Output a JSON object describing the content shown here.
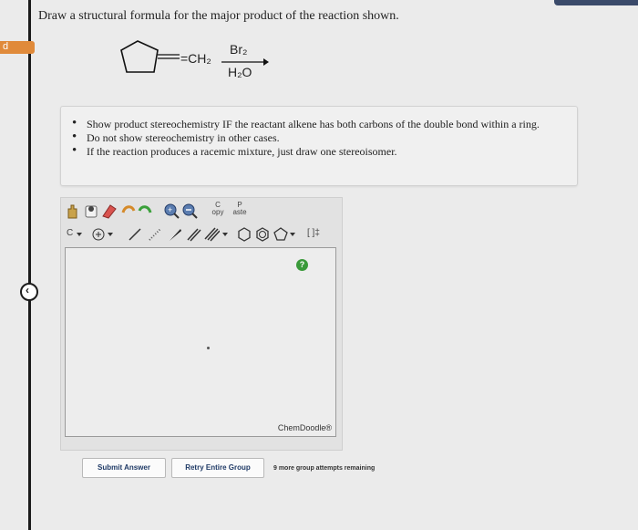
{
  "question": "Draw a structural formula for the major product of the reaction shown.",
  "reaction": {
    "substituent": "=CH₂",
    "reagent_top": "Br₂",
    "reagent_bottom": "H₂O"
  },
  "notes": [
    "Show product stereochemistry IF the reactant alkene has both carbons of the double bond within a ring.",
    "Do not show stereochemistry in other cases.",
    "If the reaction produces a racemic mixture, just draw one stereoisomer."
  ],
  "editor": {
    "element_label": "C",
    "copy_label": "C\nopy",
    "paste_label": "P\naste",
    "bracket_label": "[ ]‡",
    "help_label": "?",
    "watermark": "ChemDoodle®"
  },
  "buttons": {
    "submit": "Submit Answer",
    "retry": "Retry Entire Group"
  },
  "attempts_text": "9 more group attempts remaining",
  "side_tag": "d",
  "colors": {
    "tag": "#e08a3a",
    "help": "#3a9a3a",
    "button_text": "#1f3a66"
  }
}
